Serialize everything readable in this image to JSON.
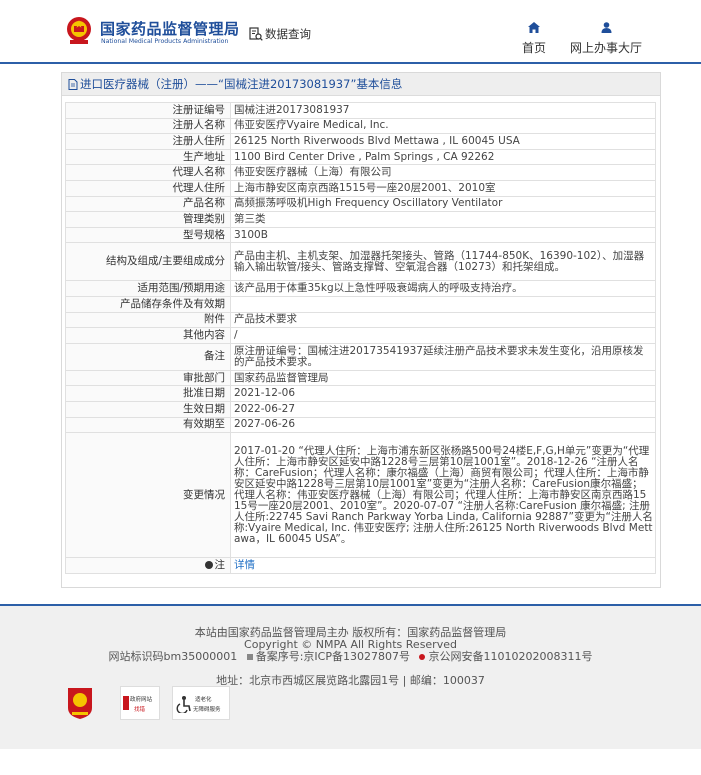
{
  "header": {
    "logo_cn": "国家药品监督管理局",
    "logo_en": "National Medical Products Administration",
    "db_query": "数据查询",
    "nav_home": "首页",
    "nav_online_hall": "网上办事大厅"
  },
  "panel": {
    "title": "进口医疗器械（注册）——“国械注进20173081937”基本信息"
  },
  "rows": [
    {
      "label": "注册证编号",
      "value": "国械注进20173081937"
    },
    {
      "label": "注册人名称",
      "value": "伟亚安医疗Vyaire Medical, Inc."
    },
    {
      "label": "注册人住所",
      "value": "26125 North Riverwoods Blvd Mettawa , IL 60045 USA"
    },
    {
      "label": "生产地址",
      "value": "1100 Bird Center Drive , Palm Springs , CA 92262"
    },
    {
      "label": "代理人名称",
      "value": "伟亚安医疗器械（上海）有限公司"
    },
    {
      "label": "代理人住所",
      "value": "上海市静安区南京西路1515号一座20层2001、2010室"
    },
    {
      "label": "产品名称",
      "value": "高频振荡呼吸机High Frequency Oscillatory Ventilator"
    },
    {
      "label": "管理类别",
      "value": "第三类"
    },
    {
      "label": "型号规格",
      "value": "3100B"
    },
    {
      "label": "结构及组成/主要组成成分",
      "value": "产品由主机、主机支架、加湿器托架接头、管路（11744-850K、16390-102）、加湿器输入输出软管/接头、管路支撑臂、空氧混合器（10273）和托架组成。"
    },
    {
      "label": "适用范围/预期用途",
      "value": "该产品用于体重35kg以上急性呼吸衰竭病人的呼吸支持治疗。"
    },
    {
      "label": "产品储存条件及有效期",
      "value": ""
    },
    {
      "label": "附件",
      "value": "产品技术要求"
    },
    {
      "label": "其他内容",
      "value": "/"
    },
    {
      "label": "备注",
      "value": "原注册证编号：国械注进20173541937延续注册产品技术要求未发生变化，沿用原核发的产品技术要求。"
    },
    {
      "label": "审批部门",
      "value": "国家药品监督管理局"
    },
    {
      "label": "批准日期",
      "value": "2021-12-06"
    },
    {
      "label": "生效日期",
      "value": "2022-06-27"
    },
    {
      "label": "有效期至",
      "value": "2027-06-26"
    },
    {
      "label": "变更情况",
      "value": "2017-01-20 “代理人住所：上海市浦东新区张杨路500号24楼E,F,G,H单元”变更为“代理人住所：上海市静安区延安中路1228号三层第10层1001室”。2018-12-26 “注册人名称：CareFusion；代理人名称：康尔福盛（上海）商贸有限公司；代理人住所：上海市静安区延安中路1228号三层第10层1001室”变更为“注册人名称：CareFusion康尔福盛；代理人名称：伟亚安医疗器械（上海）有限公司；代理人住所：上海市静安区南京西路1515号一座20层2001、2010室”。2020-07-07 “注册人名称:CareFusion 康尔福盛; 注册人住所:22745 Savi Ranch Parkway Yorba Linda, California 92887”变更为“注册人名称:Vyaire Medical, Inc. 伟亚安医疗; 注册人住所:26125 North Riverwoods Blvd Mettawa，IL 60045 USA”。"
    }
  ],
  "note_row": {
    "label": "注",
    "link": "详情"
  },
  "footer": {
    "line1": "本站由国家药品监督管理局主办 版权所有：国家药品监督管理局",
    "line2": "Copyright © NMPA All Rights Reserved",
    "line3_a": "网站标识码bm35000001",
    "line3_b": "备案序号:京ICP备13027807号",
    "line3_c": "京公网安备11010202008311号",
    "line4": "地址：北京市西城区展览路北露园1号 | 邮编：100037",
    "badge2_top": "政府网站",
    "badge2_bottom": "找错",
    "badge3_top": "适老化",
    "badge3_bottom": "无障碍服务"
  }
}
